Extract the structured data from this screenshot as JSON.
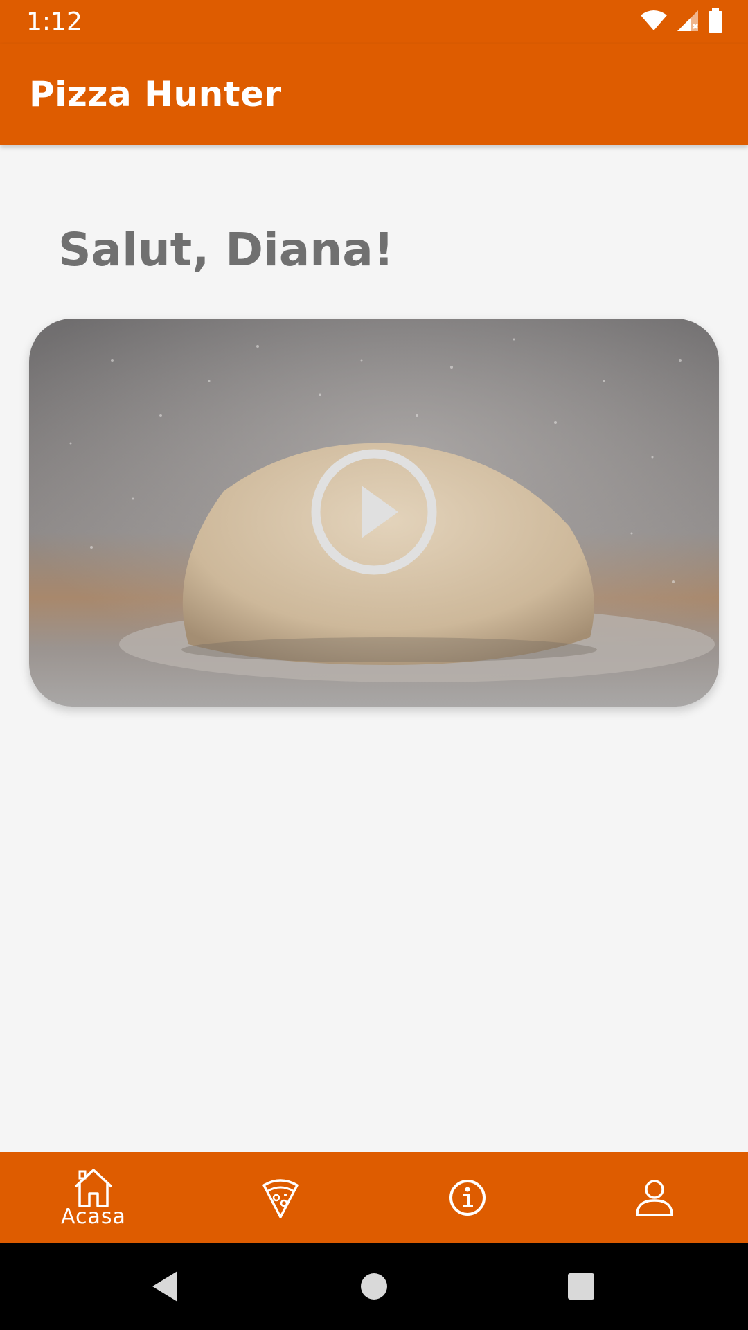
{
  "status_bar": {
    "time": "1:12",
    "icons": [
      "wifi-icon",
      "signal-icon",
      "battery-icon"
    ]
  },
  "app_bar": {
    "title": "Pizza Hunter",
    "color": "#de5c00"
  },
  "main": {
    "greeting": "Salut, Diana!",
    "video": {
      "thumbnail": "dough ball dusted with flour",
      "play_icon": "play-icon"
    }
  },
  "bottom_nav": {
    "items": [
      {
        "icon": "home-icon",
        "label": "Acasa",
        "selected": true
      },
      {
        "icon": "pizza-icon",
        "label": ""
      },
      {
        "icon": "info-icon",
        "label": ""
      },
      {
        "icon": "person-icon",
        "label": ""
      }
    ]
  },
  "system_nav": {
    "buttons": [
      "back-icon",
      "home-circle-icon",
      "recents-icon"
    ]
  }
}
